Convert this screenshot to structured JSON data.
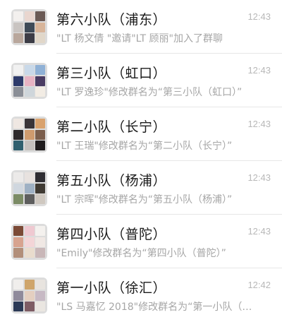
{
  "chats": [
    {
      "title": "第六小队（浦东）",
      "time": "12:43",
      "preview": "\"LT 杨文倩 \"邀请\"LT 顾丽\"加入了群聊",
      "avatar_colors": [
        "#f3f0ee",
        "#e9d6cf",
        "#6b5a55",
        "#c9c4c1",
        "#3e4a57",
        "#d8b59a",
        "#b9a79c",
        "#3c3c46",
        "#e1d7c9"
      ]
    },
    {
      "title": "第三小队（虹口）",
      "time": "12:43",
      "preview": "\"LT 罗逸珍\"修改群名为“第三小队（虹口）”",
      "avatar_colors": [
        "#f1f1f1",
        "#c9d9e9",
        "#8fb1d6",
        "#2d3a6a",
        "#e7b3c3",
        "#4a3c63",
        "#8b8f97",
        "#cfd6db",
        "#f2ece4"
      ]
    },
    {
      "title": "第二小队（长宁）",
      "time": "12:43",
      "preview": "\"LT 王瑞\"修改群名为“第二小队（长宁）”",
      "avatar_colors": [
        "#efe7e2",
        "#3a3437",
        "#d9a26d",
        "#2e2a2c",
        "#cf9b6e",
        "#7b5e4c",
        "#2f5f6e",
        "#c4c0bd",
        "#1f1c1d"
      ]
    },
    {
      "title": "第五小队（杨浦）",
      "time": "12:43",
      "preview": "\"LT 宗晖\"修改群名为“第五小队（杨浦）”",
      "avatar_colors": [
        "#eceae9",
        "#e8e2df",
        "#2f2e33",
        "#d0d7df",
        "#9fb1c4",
        "#3f3a33",
        "#7c8c66",
        "#5e5e5e",
        "#cfc8c0"
      ]
    },
    {
      "title": "第四小队（普陀）",
      "time": "12:43",
      "preview": "\"Emily\"修改群名为“第四小队（普陀）”",
      "avatar_colors": [
        "#7b4a36",
        "#efc9d1",
        "#f4f1ee",
        "#d7a38f",
        "#f3d5d7",
        "#f0e8e4",
        "#b28f7a",
        "#e9dccd",
        "#c9b7b8"
      ]
    },
    {
      "title": "第一小队（徐汇）",
      "time": "12:42",
      "preview": "\"LS 马嘉忆 2018\"修改群名为“第一小队（…",
      "avatar_colors": [
        "#f0eeec",
        "#cfa56b",
        "#e8e4df",
        "#8f8a9b",
        "#e4cfc0",
        "#c7b9c4",
        "#2c3a56",
        "#7e5c64",
        "#eae6e1"
      ]
    }
  ]
}
